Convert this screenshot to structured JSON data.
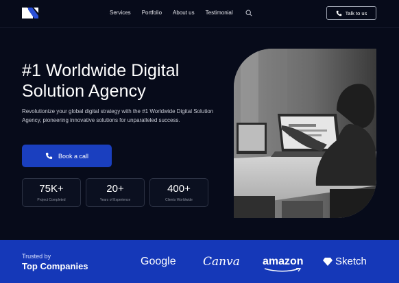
{
  "nav": {
    "logo_icon": "logo-mark-icon",
    "items": [
      "Services",
      "Portfolio",
      "About us",
      "Testimonial"
    ],
    "search_icon": "search-icon",
    "talk_button": "Talk to us",
    "talk_icon": "phone-icon"
  },
  "hero": {
    "headline_line1": "#1 Worldwide Digital",
    "headline_line2": "Solution Agency",
    "description": "Revolutionize your global digital strategy with the #1 Worldwide Digital Solution Agency, pioneering innovative solutions for unparalleled success.",
    "cta_label": "Book a call",
    "cta_icon": "phone-icon",
    "stats": [
      {
        "value": "75K+",
        "label": "Project Completed"
      },
      {
        "value": "20+",
        "label": "Years of Experience"
      },
      {
        "value": "400+",
        "label": "Clients Worldwide"
      }
    ],
    "photo": "office-worker-laptop-photo"
  },
  "trusted": {
    "small": "Trusted by",
    "big": "Top Companies",
    "brands": [
      "Google",
      "Canva",
      "amazon",
      "Sketch"
    ]
  },
  "colors": {
    "background": "#070b1a",
    "accent": "#1a3fbf",
    "band": "#1538b8"
  }
}
